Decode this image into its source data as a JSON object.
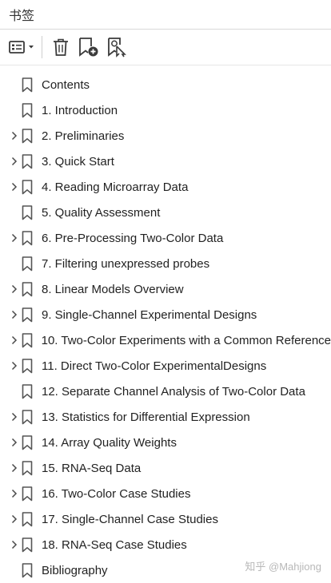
{
  "header": {
    "title": "书签"
  },
  "toolbar": {
    "buttons": [
      "options-dropdown",
      "delete-bookmark",
      "new-bookmark",
      "find-current-bookmark"
    ]
  },
  "bookmarks": [
    {
      "label": "Contents",
      "expandable": false
    },
    {
      "label": "1. Introduction",
      "expandable": false
    },
    {
      "label": "2. Preliminaries",
      "expandable": true
    },
    {
      "label": "3. Quick Start",
      "expandable": true
    },
    {
      "label": "4. Reading Microarray Data",
      "expandable": true
    },
    {
      "label": "5. Quality Assessment",
      "expandable": false
    },
    {
      "label": "6. Pre-Processing Two-Color Data",
      "expandable": true
    },
    {
      "label": "7. Filtering unexpressed probes",
      "expandable": false
    },
    {
      "label": "8. Linear Models Overview",
      "expandable": true
    },
    {
      "label": "9. Single-Channel Experimental Designs",
      "expandable": true
    },
    {
      "label": "10. Two-Color Experiments with a Common Reference",
      "expandable": true
    },
    {
      "label": "11. Direct Two-Color ExperimentalDesigns",
      "expandable": true
    },
    {
      "label": "12. Separate Channel Analysis of Two-Color Data",
      "expandable": false
    },
    {
      "label": "13. Statistics for Differential Expression",
      "expandable": true
    },
    {
      "label": "14. Array Quality Weights",
      "expandable": true
    },
    {
      "label": "15. RNA-Seq Data",
      "expandable": true
    },
    {
      "label": "16. Two-Color Case Studies",
      "expandable": true
    },
    {
      "label": "17. Single-Channel Case Studies",
      "expandable": true
    },
    {
      "label": "18. RNA-Seq Case Studies",
      "expandable": true
    },
    {
      "label": "Bibliography",
      "expandable": false
    }
  ],
  "watermark": "知乎 @Mahjiong"
}
